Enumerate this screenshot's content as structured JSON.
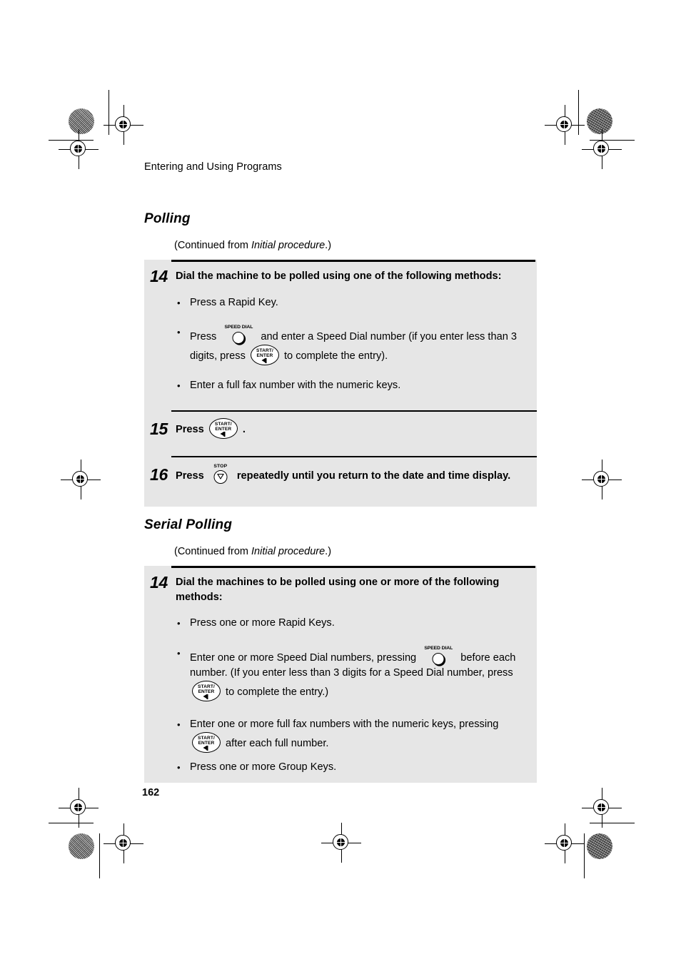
{
  "document": {
    "running_head": "Entering and Using Programs",
    "page_number": "162"
  },
  "sections": [
    {
      "title": "Polling",
      "continued_prefix": "(Continued from ",
      "continued_italic": "Initial procedure",
      "continued_suffix": ".)",
      "steps": [
        {
          "number": "14",
          "heading": "Dial the machine to be polled using one of the following methods:",
          "bullets": [
            {
              "parts": [
                {
                  "text": "Press a Rapid Key."
                }
              ]
            },
            {
              "parts": [
                {
                  "text": "Press "
                },
                {
                  "key": "speed-dial"
                },
                {
                  "text": " and enter a Speed Dial number (if you enter less than 3 digits, press "
                },
                {
                  "key": "start-enter"
                },
                {
                  "text": " to complete the entry)."
                }
              ]
            },
            {
              "parts": [
                {
                  "text": "Enter a full fax number with the numeric keys."
                }
              ]
            }
          ]
        },
        {
          "number": "15",
          "heading_parts": [
            {
              "text": "Press "
            },
            {
              "key": "start-enter"
            },
            {
              "text": " ."
            }
          ]
        },
        {
          "number": "16",
          "heading_parts": [
            {
              "text": "Press "
            },
            {
              "key": "stop"
            },
            {
              "text": " repeatedly until you return to the date and time display."
            }
          ]
        }
      ]
    },
    {
      "title": "Serial Polling",
      "continued_prefix": "(Continued from ",
      "continued_italic": "Initial procedure",
      "continued_suffix": ".)",
      "steps": [
        {
          "number": "14",
          "heading": "Dial the machines to be polled using one or more of the following methods:",
          "bullets": [
            {
              "parts": [
                {
                  "text": "Press one or more Rapid Keys."
                }
              ]
            },
            {
              "parts": [
                {
                  "text": "Enter one or more Speed Dial numbers, pressing "
                },
                {
                  "key": "speed-dial"
                },
                {
                  "text": " before each number. (If you enter less than 3 digits for a Speed Dial number, press "
                },
                {
                  "key": "start-enter"
                },
                {
                  "text": " to complete the entry.)"
                }
              ]
            },
            {
              "parts": [
                {
                  "text": "Enter one or more full fax numbers with the numeric keys, pressing "
                },
                {
                  "key": "start-enter"
                },
                {
                  "text": " after each full number."
                }
              ]
            },
            {
              "parts": [
                {
                  "text": "Press one or more Group Keys."
                }
              ]
            }
          ]
        }
      ]
    }
  ],
  "keys": {
    "start_enter": {
      "line1": "START/",
      "line2": "ENTER",
      "name": "START/ENTER key"
    },
    "speed_dial": {
      "caption": "SPEED DIAL",
      "name": "SPEED DIAL key"
    },
    "stop": {
      "caption": "STOP",
      "name": "STOP key"
    }
  },
  "colors": {
    "step_box_background": "#e6e6e6",
    "rule": "#000000",
    "page_background": "#ffffff",
    "text": "#000000"
  }
}
